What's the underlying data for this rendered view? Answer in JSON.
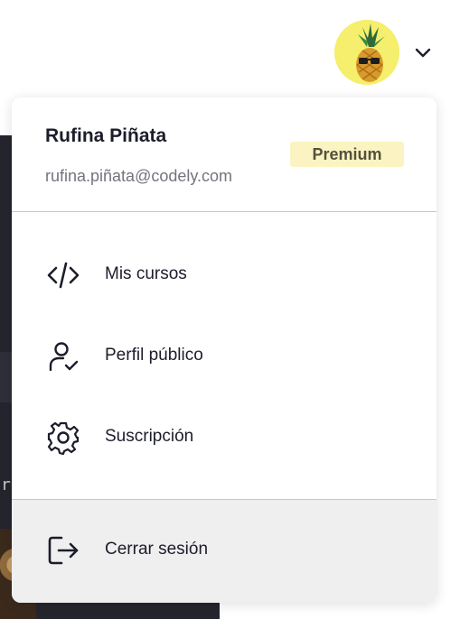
{
  "user": {
    "name": "Rufina Piñata",
    "email": "rufina.piñata@codely.com",
    "plan_badge": "Premium",
    "avatar_icon": "pineapple-with-sunglasses-avatar"
  },
  "menu": {
    "items": [
      {
        "label": "Mis cursos",
        "icon": "code-icon"
      },
      {
        "label": "Perfil público",
        "icon": "user-check-icon"
      },
      {
        "label": "Suscripción",
        "icon": "gear-icon"
      }
    ],
    "logout": {
      "label": "Cerrar sesión",
      "icon": "logout-icon"
    }
  },
  "colors": {
    "text": "#1c1d2b",
    "muted": "#73757d",
    "badge_bg": "#fbf4c2",
    "avatar_bg": "#f5ef6d",
    "logout_bg": "#efefef"
  }
}
